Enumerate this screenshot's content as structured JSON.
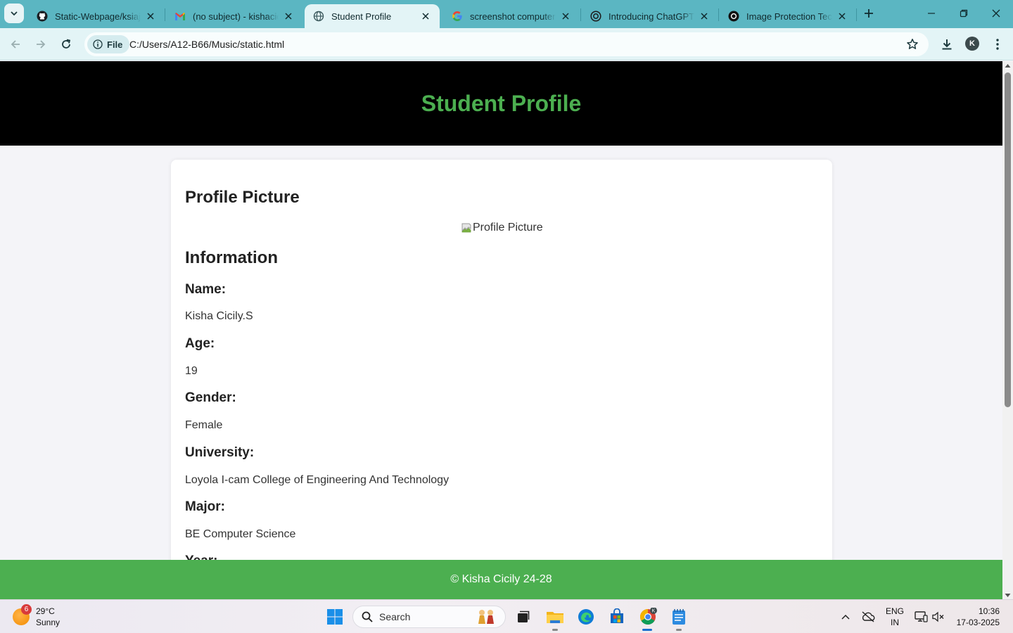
{
  "browser": {
    "tabs": [
      {
        "title": "Static-Webpage/ksiaj.html",
        "icon": "github-icon"
      },
      {
        "title": "(no subject) - kishacicily",
        "icon": "gmail-icon"
      },
      {
        "title": "Student Profile",
        "icon": "globe-icon",
        "active": true
      },
      {
        "title": "screenshot computer - Google",
        "icon": "google-icon"
      },
      {
        "title": "Introducing ChatGPT | OpenAI",
        "icon": "openai-icon"
      },
      {
        "title": "Image Protection Techniques",
        "icon": "openai-icon"
      }
    ],
    "address": {
      "chip_label": "File",
      "url": "C:/Users/A12-B66/Music/static.html"
    },
    "profile_initial": "K"
  },
  "page": {
    "header_title": "Student Profile",
    "profile_heading": "Profile Picture",
    "profile_image_alt": "Profile Picture",
    "info_heading": "Information",
    "fields": [
      {
        "label": "Name:",
        "value": "Kisha Cicily.S"
      },
      {
        "label": "Age:",
        "value": "19"
      },
      {
        "label": "Gender:",
        "value": "Female"
      },
      {
        "label": "University:",
        "value": "Loyola I-cam College of Engineering And Technology"
      },
      {
        "label": "Major:",
        "value": "BE Computer Science"
      },
      {
        "label": "Year:"
      }
    ],
    "footer": "© Kisha Cicily 24-28",
    "colors": {
      "header_bg": "#000000",
      "accent": "#4caf50",
      "footer_bg": "#4caf50"
    }
  },
  "taskbar": {
    "weather": {
      "temp": "29°C",
      "condition": "Sunny",
      "badge": "6"
    },
    "search_placeholder": "Search",
    "language": {
      "line1": "ENG",
      "line2": "IN"
    },
    "clock": {
      "time": "10:36",
      "date": "17-03-2025"
    }
  }
}
